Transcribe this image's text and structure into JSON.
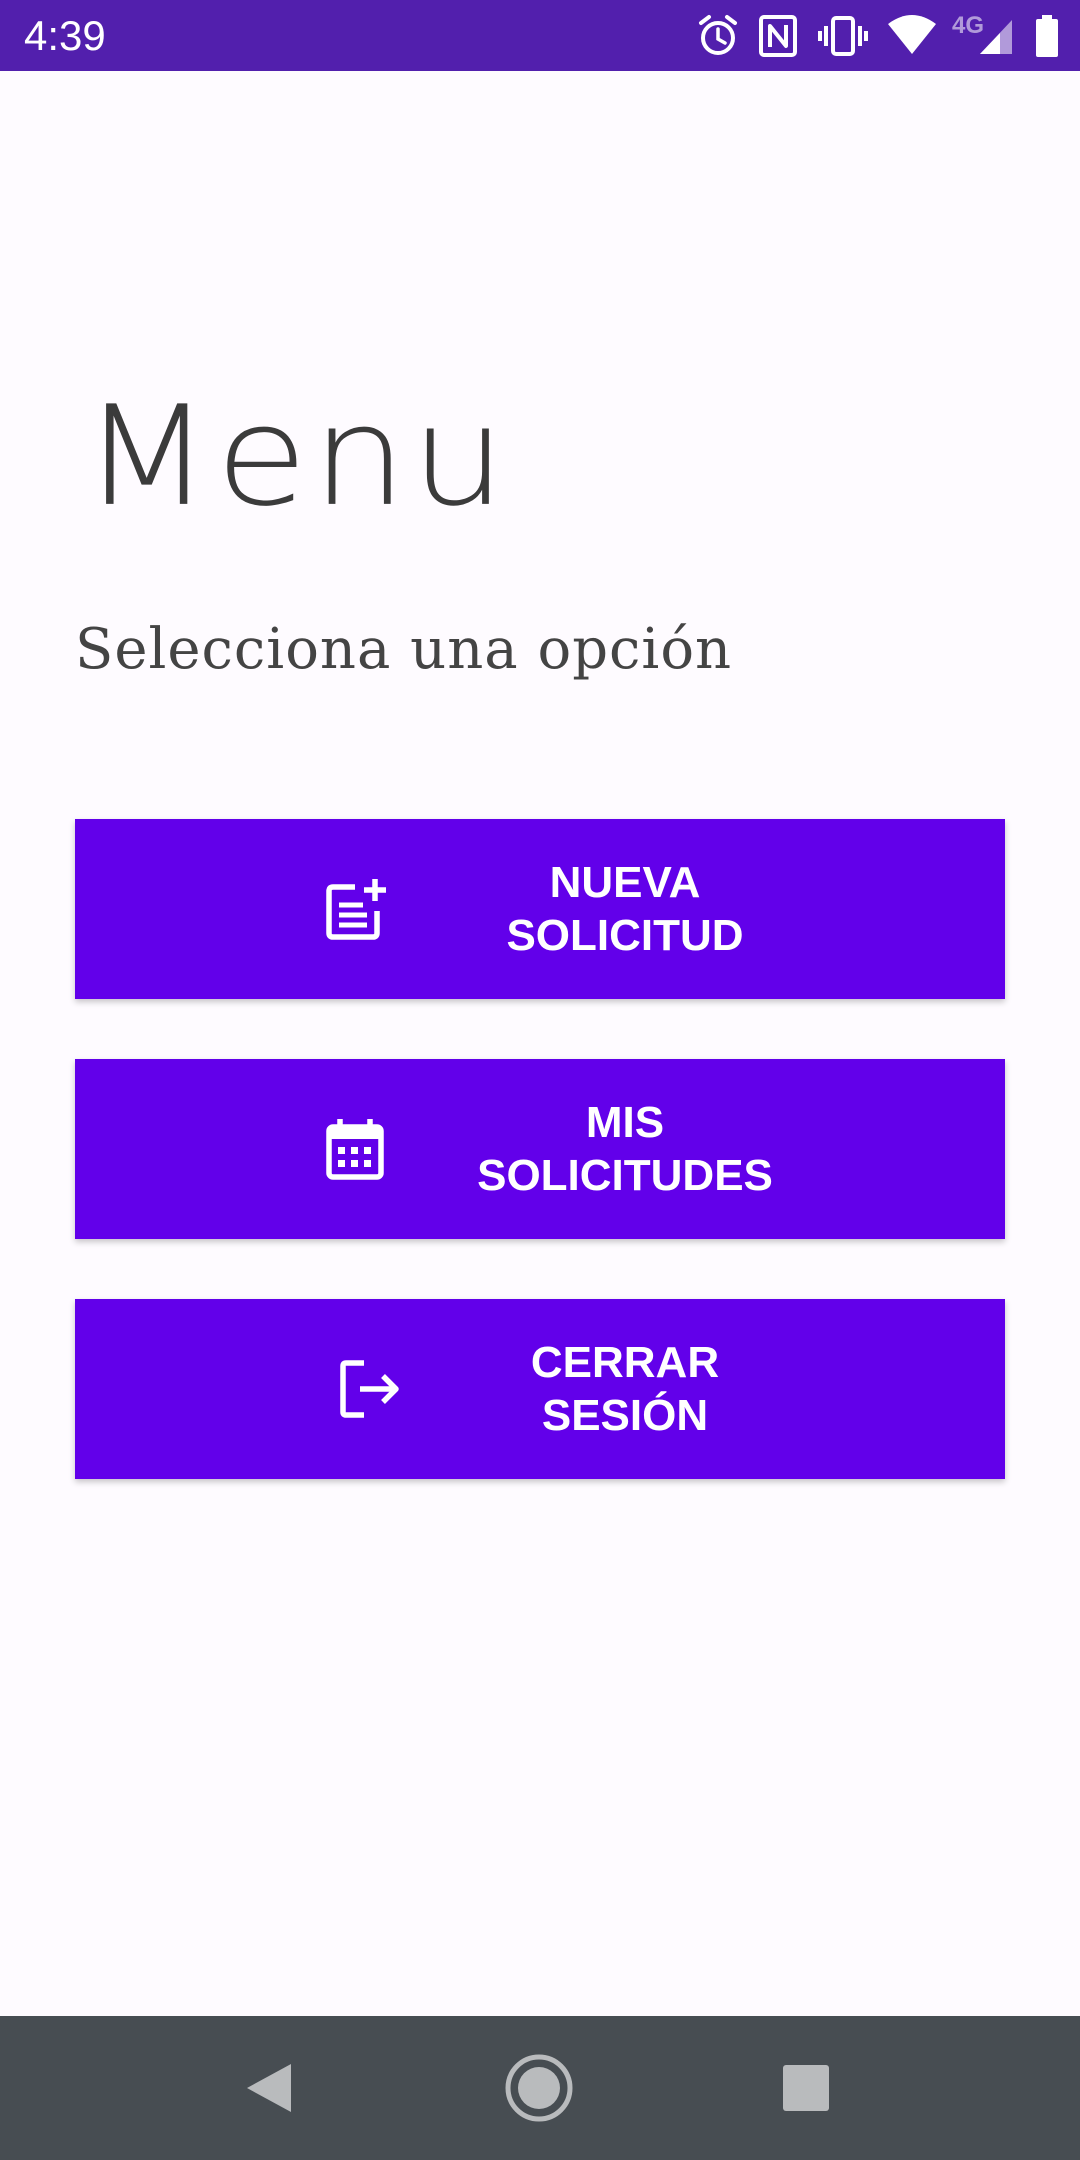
{
  "status_bar": {
    "time": "4:39",
    "network_label": "4G",
    "icons": [
      "alarm-icon",
      "nfc-icon",
      "vibrate-icon",
      "wifi-icon",
      "signal-icon",
      "battery-icon"
    ],
    "background_color": "#521fad"
  },
  "main": {
    "title": "Menu",
    "subtitle": "Selecciona una opción"
  },
  "menu": {
    "accent_color": "#6200ea",
    "items": [
      {
        "line1": "NUEVA",
        "line2": "SOLICITUD",
        "icon": "post-add-icon"
      },
      {
        "line1": "MIS",
        "line2": "SOLICITUDES",
        "icon": "calendar-icon"
      },
      {
        "line1": "CERRAR",
        "line2": "SESIÓN",
        "icon": "logout-icon"
      }
    ]
  },
  "nav_bar": {
    "icons": [
      "back-icon",
      "home-icon",
      "recents-icon"
    ],
    "background_color": "#474d52"
  }
}
